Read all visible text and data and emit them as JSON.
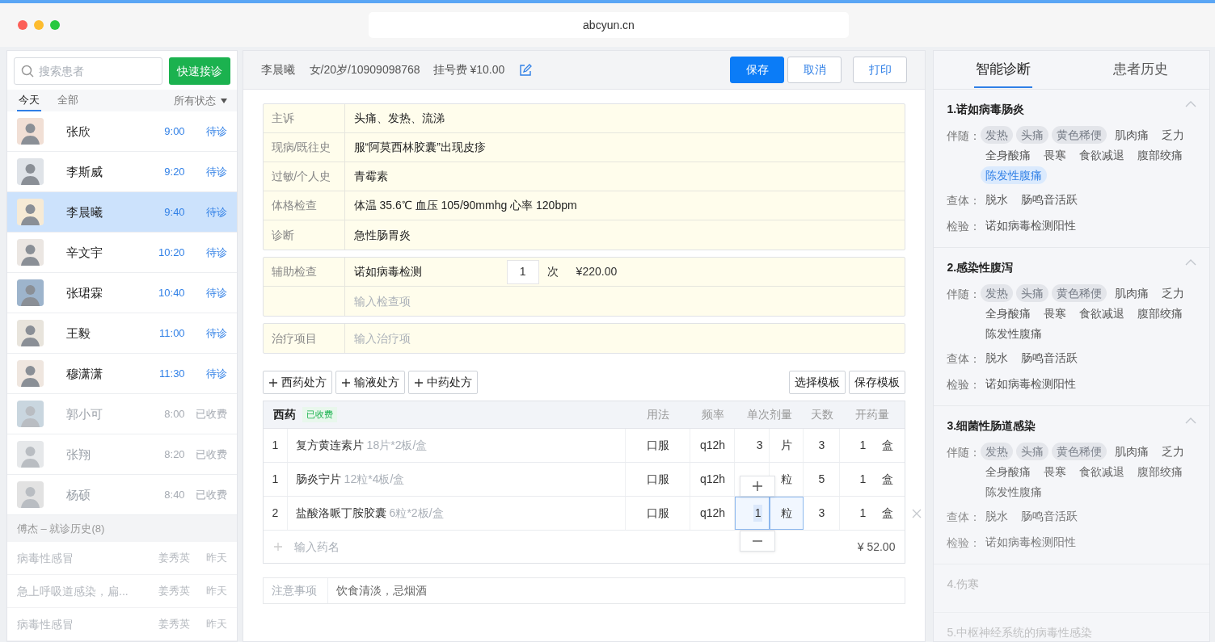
{
  "browser": {
    "url": "abcyun.cn"
  },
  "left": {
    "search_placeholder": "搜索患者",
    "quick_button": "快速接诊",
    "tabs": [
      {
        "label": "今天",
        "selected": true
      },
      {
        "label": "全部",
        "selected": false
      }
    ],
    "filter": "所有状态",
    "patients": [
      {
        "name": "张欣",
        "time": "9:00",
        "status": "待诊",
        "kind": "waiting",
        "selected": false
      },
      {
        "name": "李斯威",
        "time": "9:20",
        "status": "待诊",
        "kind": "waiting",
        "selected": false
      },
      {
        "name": "李晨曦",
        "time": "9:40",
        "status": "待诊",
        "kind": "waiting",
        "selected": true
      },
      {
        "name": "辛文宇",
        "time": "10:20",
        "status": "待诊",
        "kind": "waiting",
        "selected": false
      },
      {
        "name": "张珺霖",
        "time": "10:40",
        "status": "待诊",
        "kind": "waiting",
        "selected": false
      },
      {
        "name": "王毅",
        "time": "11:00",
        "status": "待诊",
        "kind": "waiting",
        "selected": false
      },
      {
        "name": "穆潇潇",
        "time": "11:30",
        "status": "待诊",
        "kind": "waiting",
        "selected": false
      },
      {
        "name": "郭小可",
        "time": "8:00",
        "status": "已收费",
        "kind": "paid",
        "selected": false
      },
      {
        "name": "张翔",
        "time": "8:20",
        "status": "已收费",
        "kind": "paid",
        "selected": false
      },
      {
        "name": "杨硕",
        "time": "8:40",
        "status": "已收费",
        "kind": "paid",
        "selected": false
      }
    ],
    "history_title": "傅杰 – 就诊历史(8)",
    "history": [
      {
        "diagnosis": "病毒性感冒",
        "doctor": "姜秀英",
        "date": "昨天"
      },
      {
        "diagnosis": "急上呼吸道感染，扁...",
        "doctor": "姜秀英",
        "date": "昨天"
      },
      {
        "diagnosis": "病毒性感冒",
        "doctor": "姜秀英",
        "date": "昨天"
      }
    ]
  },
  "header": {
    "patient_name": "李晨曦",
    "info": "女/20岁/10909098768",
    "fee": "挂号费 ¥10.00",
    "buttons": [
      {
        "label": "保存",
        "primary": true
      },
      {
        "label": "取消",
        "primary": false
      },
      {
        "label": "打印",
        "primary": false
      }
    ]
  },
  "record": {
    "rows": [
      {
        "label": "主诉",
        "value": "头痛、发热、流涕"
      },
      {
        "label": "现病/既往史",
        "value": "服“阿莫西林胶囊”出现皮疹"
      },
      {
        "label": "过敏/个人史",
        "value": "青霉素"
      },
      {
        "label": "体格检查",
        "value": "体温 35.6℃   血压 105/90mmhg   心率 120bpm"
      },
      {
        "label": "诊断",
        "value": "急性肠胃炎"
      }
    ],
    "aux": {
      "label": "辅助检查",
      "item": "诺如病毒检测",
      "count": "1",
      "unit": "次",
      "price": "¥220.00",
      "placeholder": "输入检查项"
    },
    "treatment": {
      "label": "治疗项目",
      "placeholder": "输入治疗项"
    }
  },
  "rx_buttons": [
    "西药处方",
    "输液处方",
    "中药处方"
  ],
  "template_buttons": [
    "选择模板",
    "保存模板"
  ],
  "prescription": {
    "title": "西药",
    "badge": "已收费",
    "columns": [
      "用法",
      "频率",
      "单次剂量",
      "天数",
      "开药量"
    ],
    "rows": [
      {
        "no": "1",
        "name": "复方黄连素片",
        "spec": "18片*2板/盒",
        "usage": "口服",
        "freq": "q12h",
        "dose": "3",
        "dose_unit": "片",
        "days": "3",
        "qty": "1",
        "qty_unit": "盒",
        "editing": false
      },
      {
        "no": "1",
        "name": "肠炎宁片",
        "spec": "12粒*4板/盒",
        "usage": "口服",
        "freq": "q12h",
        "dose_unit": "粒",
        "days": "5",
        "qty": "1",
        "qty_unit": "盒",
        "editing": false
      },
      {
        "no": "2",
        "name": "盐酸洛哌丁胺胶囊",
        "spec": "6粒*2板/盒",
        "usage": "口服",
        "freq": "q12h",
        "dose": "1",
        "dose_unit": "粒",
        "days": "3",
        "qty": "1",
        "qty_unit": "盒",
        "editing": true
      }
    ],
    "add_placeholder": "输入药名",
    "total": "¥ 52.00"
  },
  "notes": {
    "label": "注意事项",
    "value": "饮食清淡，忌烟酒"
  },
  "right": {
    "tabs": [
      {
        "label": "智能诊断",
        "selected": true
      },
      {
        "label": "患者历史",
        "selected": false
      }
    ],
    "diagnoses": [
      {
        "title": "1.诺如病毒肠炎",
        "expanded": true,
        "groups": [
          {
            "label": "伴随：",
            "items": [
              {
                "text": "发热",
                "kind": "matched"
              },
              {
                "text": "头痛",
                "kind": "matched"
              },
              {
                "text": "黄色稀便",
                "kind": "matched"
              },
              {
                "text": "肌肉痛",
                "kind": "plain"
              },
              {
                "text": "乏力",
                "kind": "plain"
              },
              {
                "text": "全身酸痛",
                "kind": "plain"
              },
              {
                "text": "畏寒",
                "kind": "plain"
              },
              {
                "text": "食欲减退",
                "kind": "plain"
              },
              {
                "text": "腹部绞痛",
                "kind": "plain"
              },
              {
                "text": "陈发性腹痛",
                "kind": "highlight"
              }
            ]
          },
          {
            "label": "查体：",
            "items": [
              {
                "text": "脱水",
                "kind": "plain"
              },
              {
                "text": "肠鸣音活跃",
                "kind": "plain"
              }
            ]
          },
          {
            "label": "检验：",
            "items": [
              {
                "text": "诺如病毒检测阳性",
                "kind": "plain"
              }
            ]
          }
        ]
      },
      {
        "title": "2.感染性腹泻",
        "expanded": true,
        "groups": [
          {
            "label": "伴随：",
            "items": [
              {
                "text": "发热",
                "kind": "matched"
              },
              {
                "text": "头痛",
                "kind": "matched"
              },
              {
                "text": "黄色稀便",
                "kind": "matched"
              },
              {
                "text": "肌肉痛",
                "kind": "plain"
              },
              {
                "text": "乏力",
                "kind": "plain"
              },
              {
                "text": "全身酸痛",
                "kind": "plain"
              },
              {
                "text": "畏寒",
                "kind": "plain"
              },
              {
                "text": "食欲减退",
                "kind": "plain"
              },
              {
                "text": "腹部绞痛",
                "kind": "plain"
              },
              {
                "text": "陈发性腹痛",
                "kind": "plain"
              }
            ]
          },
          {
            "label": "查体：",
            "items": [
              {
                "text": "脱水",
                "kind": "plain"
              },
              {
                "text": "肠鸣音活跃",
                "kind": "plain"
              }
            ]
          },
          {
            "label": "检验：",
            "items": [
              {
                "text": "诺如病毒检测阳性",
                "kind": "plain"
              }
            ]
          }
        ]
      },
      {
        "title": "3.细菌性肠道感染",
        "expanded": true,
        "groups": [
          {
            "label": "伴随：",
            "items": [
              {
                "text": "发热",
                "kind": "matched"
              },
              {
                "text": "头痛",
                "kind": "matched"
              },
              {
                "text": "黄色稀便",
                "kind": "matched"
              },
              {
                "text": "肌肉痛",
                "kind": "plain"
              },
              {
                "text": "乏力",
                "kind": "plain"
              },
              {
                "text": "全身酸痛",
                "kind": "plain"
              },
              {
                "text": "畏寒",
                "kind": "plain"
              },
              {
                "text": "食欲减退",
                "kind": "plain"
              },
              {
                "text": "腹部绞痛",
                "kind": "plain"
              },
              {
                "text": "陈发性腹痛",
                "kind": "plain"
              }
            ]
          },
          {
            "label": "查体：",
            "items": [
              {
                "text": "脱水",
                "kind": "plain"
              },
              {
                "text": "肠鸣音活跃",
                "kind": "plain"
              }
            ]
          },
          {
            "label": "检验：",
            "items": [
              {
                "text": "诺如病毒检测阳性",
                "kind": "plain"
              }
            ]
          }
        ]
      },
      {
        "title": "4.伤寒",
        "expanded": false
      },
      {
        "title": "5.中枢神经系统的病毒性感染",
        "expanded": false
      }
    ]
  }
}
